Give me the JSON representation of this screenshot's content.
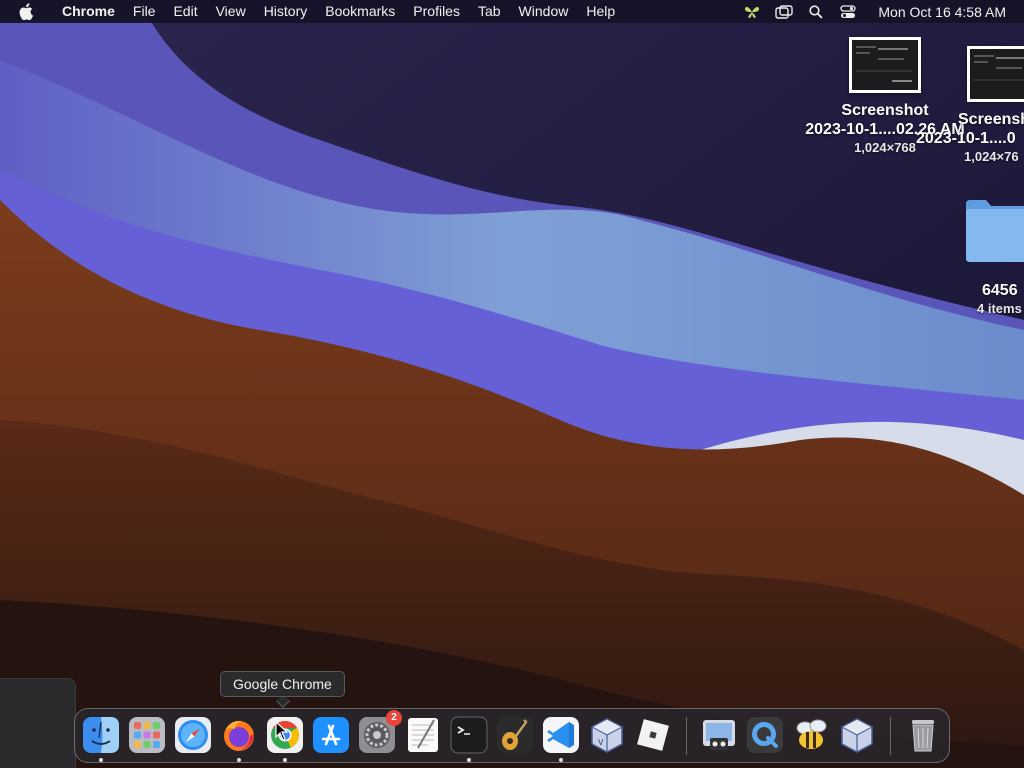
{
  "menubar": {
    "app_name": "Chrome",
    "menus": [
      "File",
      "Edit",
      "View",
      "History",
      "Bookmarks",
      "Profiles",
      "Tab",
      "Window",
      "Help"
    ],
    "status_icons": [
      "butterfly-icon",
      "screen-mirroring-icon",
      "spotlight-search-icon",
      "control-center-icon"
    ],
    "clock": "Mon Oct 16  4:58 AM"
  },
  "desktop": {
    "items": [
      {
        "name": "Screenshot",
        "sub": "2023-10-1....02.26 AM",
        "meta": "1,024×768",
        "kind": "screenshot"
      },
      {
        "name": "Screensh",
        "sub": "2023-10-1....0",
        "meta": "1,024×76",
        "kind": "screenshot"
      },
      {
        "name": "6456",
        "sub": "",
        "meta": "4 items",
        "kind": "folder"
      }
    ]
  },
  "dock": {
    "tooltip": "Google Chrome",
    "apps": [
      {
        "name": "Finder",
        "icon": "finder-icon"
      },
      {
        "name": "Launchpad",
        "icon": "launchpad-icon"
      },
      {
        "name": "Safari",
        "icon": "safari-icon"
      },
      {
        "name": "Firefox",
        "icon": "firefox-icon"
      },
      {
        "name": "Google Chrome",
        "icon": "chrome-icon"
      },
      {
        "name": "App Store",
        "icon": "app-store-icon"
      },
      {
        "name": "System Settings",
        "icon": "system-settings-icon",
        "badge": "2"
      },
      {
        "name": "TextEdit",
        "icon": "textedit-icon"
      },
      {
        "name": "Terminal",
        "icon": "terminal-icon"
      },
      {
        "name": "GarageBand",
        "icon": "garageband-icon"
      },
      {
        "name": "Visual Studio Code",
        "icon": "vscode-icon"
      },
      {
        "name": "VirtualBox",
        "icon": "virtualbox-icon"
      },
      {
        "name": "Roblox",
        "icon": "roblox-icon"
      },
      {
        "name": "Preview",
        "icon": "preview-icon"
      },
      {
        "name": "QuickTime Player",
        "icon": "quicktime-icon"
      },
      {
        "name": "Cyberduck",
        "icon": "bee-app-icon"
      },
      {
        "name": "VirtualBox VM",
        "icon": "virtualbox-vm-icon"
      },
      {
        "name": "Trash",
        "icon": "trash-icon"
      }
    ]
  },
  "colors": {
    "wallpaper_sky": "#211c3e",
    "wave_blue": "#6b63d8",
    "wave_light": "#7c9ad0",
    "wave_brown": "#7a3a1c",
    "badge": "#e8443a"
  }
}
